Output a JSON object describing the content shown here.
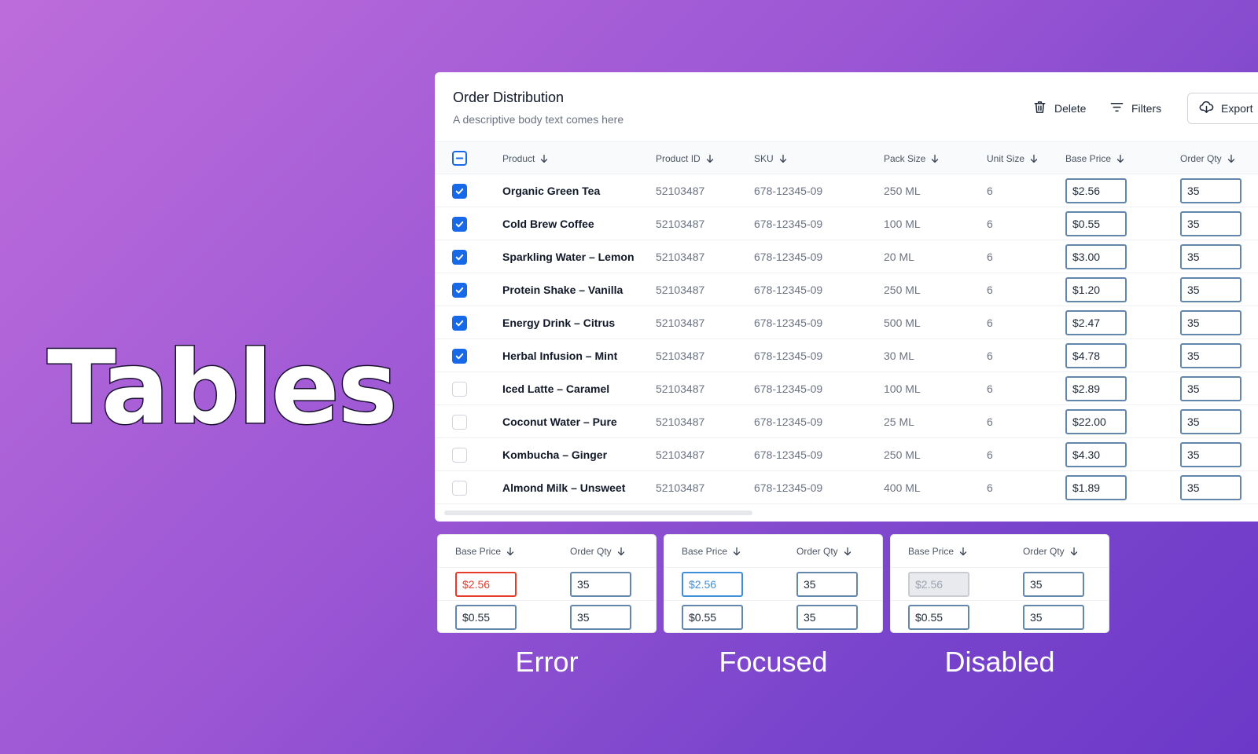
{
  "hero": {
    "title": "Tables"
  },
  "card": {
    "title": "Order Distribution",
    "subtitle": "A descriptive body text comes here",
    "actions": {
      "delete": "Delete",
      "filters": "Filters",
      "export": "Export"
    }
  },
  "table": {
    "headers": {
      "product": "Product",
      "product_id": "Product ID",
      "sku": "SKU",
      "pack_size": "Pack Size",
      "unit_size": "Unit Size",
      "base_price": "Base Price",
      "order_qty": "Order Qty"
    },
    "header_checkbox": "indeterminate",
    "rows": [
      {
        "checked": true,
        "product": "Organic Green Tea",
        "product_id": "52103487",
        "sku": "678-12345-09",
        "pack_size": "250 ML",
        "unit_size": "6",
        "base_price": "$2.56",
        "order_qty": "35"
      },
      {
        "checked": true,
        "product": "Cold Brew Coffee",
        "product_id": "52103487",
        "sku": "678-12345-09",
        "pack_size": "100 ML",
        "unit_size": "6",
        "base_price": "$0.55",
        "order_qty": "35"
      },
      {
        "checked": true,
        "product": "Sparkling Water – Lemon",
        "product_id": "52103487",
        "sku": "678-12345-09",
        "pack_size": "20 ML",
        "unit_size": "6",
        "base_price": "$3.00",
        "order_qty": "35"
      },
      {
        "checked": true,
        "product": "Protein Shake – Vanilla",
        "product_id": "52103487",
        "sku": "678-12345-09",
        "pack_size": "250 ML",
        "unit_size": "6",
        "base_price": "$1.20",
        "order_qty": "35"
      },
      {
        "checked": true,
        "product": "Energy Drink – Citrus",
        "product_id": "52103487",
        "sku": "678-12345-09",
        "pack_size": "500 ML",
        "unit_size": "6",
        "base_price": "$2.47",
        "order_qty": "35"
      },
      {
        "checked": true,
        "product": "Herbal Infusion – Mint",
        "product_id": "52103487",
        "sku": "678-12345-09",
        "pack_size": "30 ML",
        "unit_size": "6",
        "base_price": "$4.78",
        "order_qty": "35"
      },
      {
        "checked": false,
        "product": "Iced Latte – Caramel",
        "product_id": "52103487",
        "sku": "678-12345-09",
        "pack_size": "100 ML",
        "unit_size": "6",
        "base_price": "$2.89",
        "order_qty": "35"
      },
      {
        "checked": false,
        "product": "Coconut Water – Pure",
        "product_id": "52103487",
        "sku": "678-12345-09",
        "pack_size": "25 ML",
        "unit_size": "6",
        "base_price": "$22.00",
        "order_qty": "35"
      },
      {
        "checked": false,
        "product": "Kombucha – Ginger",
        "product_id": "52103487",
        "sku": "678-12345-09",
        "pack_size": "250 ML",
        "unit_size": "6",
        "base_price": "$4.30",
        "order_qty": "35"
      },
      {
        "checked": false,
        "product": "Almond Milk – Unsweet",
        "product_id": "52103487",
        "sku": "678-12345-09",
        "pack_size": "400 ML",
        "unit_size": "6",
        "base_price": "$1.89",
        "order_qty": "35"
      }
    ]
  },
  "states": [
    {
      "caption": "Error",
      "variant": "error",
      "headers": {
        "base_price": "Base Price",
        "order_qty": "Order Qty"
      },
      "rows": [
        {
          "base_price": "$2.56",
          "order_qty": "35"
        },
        {
          "base_price": "$0.55",
          "order_qty": "35"
        }
      ]
    },
    {
      "caption": "Focused",
      "variant": "focused",
      "headers": {
        "base_price": "Base Price",
        "order_qty": "Order Qty"
      },
      "rows": [
        {
          "base_price": "$2.56",
          "order_qty": "35"
        },
        {
          "base_price": "$0.55",
          "order_qty": "35"
        }
      ]
    },
    {
      "caption": "Disabled",
      "variant": "disabled",
      "headers": {
        "base_price": "Base Price",
        "order_qty": "Order Qty"
      },
      "rows": [
        {
          "base_price": "$2.56",
          "order_qty": "35"
        },
        {
          "base_price": "$0.55",
          "order_qty": "35"
        }
      ]
    }
  ],
  "colors": {
    "accent": "#1769e8",
    "input_border": "#6287ab",
    "error": "#e53b2c",
    "focused": "#3f8ed8",
    "disabled_bg": "#e8eaed"
  },
  "icons": {
    "delete": "trash-icon",
    "filters": "filter-lines-icon",
    "export": "cloud-download-icon",
    "sort": "arrow-down-icon",
    "check": "check-icon"
  }
}
